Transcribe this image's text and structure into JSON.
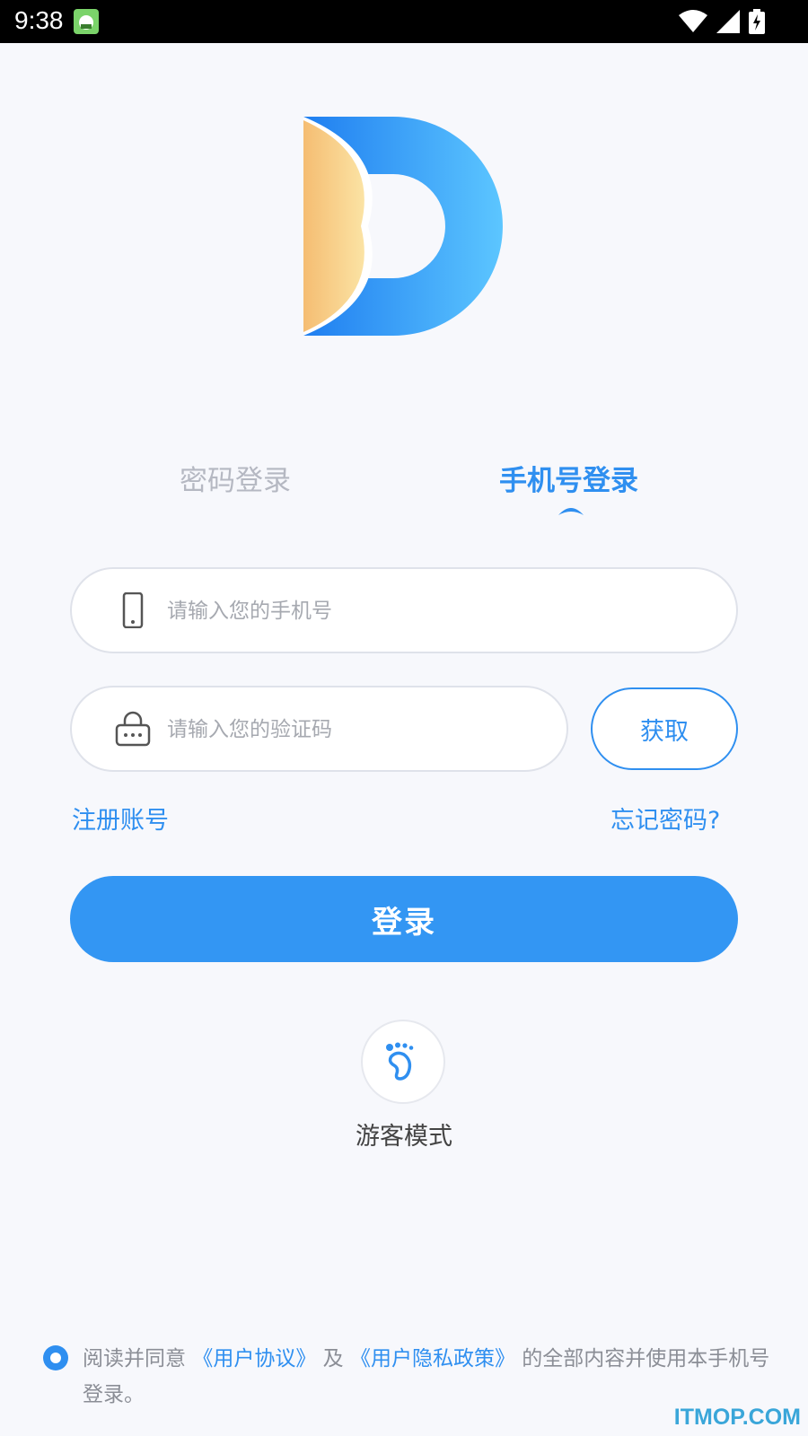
{
  "status_bar": {
    "time": "9:38",
    "icons": [
      "app-notification-icon",
      "wifi-icon",
      "cellular-signal-icon",
      "battery-charging-icon"
    ]
  },
  "tabs": {
    "password_login": "密码登录",
    "phone_login": "手机号登录",
    "active": "phone_login"
  },
  "form": {
    "phone_placeholder": "请输入您的手机号",
    "code_placeholder": "请输入您的验证码",
    "get_code_label": "获取"
  },
  "links": {
    "register": "注册账号",
    "forgot_password": "忘记密码?"
  },
  "login_button": "登录",
  "guest": {
    "label": "游客模式",
    "icon": "footprint-icon"
  },
  "agreement": {
    "checked": true,
    "prefix": "阅读并同意",
    "user_agreement": "《用户协议》",
    "and": "及",
    "privacy_policy": "《用户隐私政策》",
    "suffix": "的全部内容并使用本手机号登录。"
  },
  "watermark": "ITMOP.COM",
  "colors": {
    "accent": "#2f8ff0",
    "button": "#3396f3",
    "background": "#f7f8fc"
  }
}
